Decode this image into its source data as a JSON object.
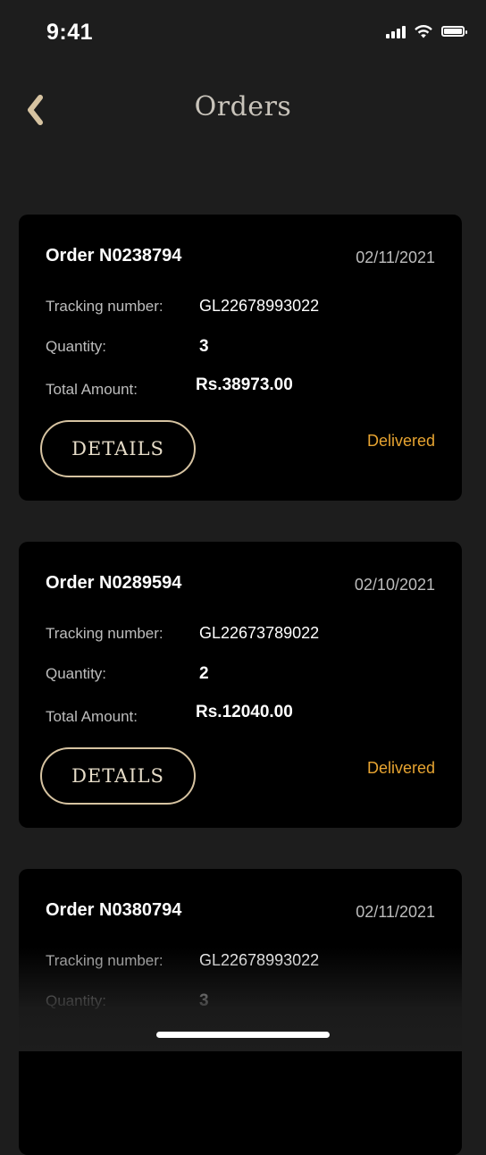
{
  "status_bar": {
    "time": "9:41"
  },
  "header": {
    "title": "Orders",
    "back_icon": "chevron-left-icon"
  },
  "labels": {
    "tracking": "Tracking number:",
    "quantity": "Quantity:",
    "total": "Total Amount:",
    "details_button": "DETAILS"
  },
  "orders": [
    {
      "title": "Order N0238794",
      "date": "02/11/2021",
      "tracking_number": "GL22678993022",
      "quantity": "3",
      "total_amount": "Rs.38973.00",
      "status": "Delivered"
    },
    {
      "title": "Order N0289594",
      "date": "02/10/2021",
      "tracking_number": "GL22673789022",
      "quantity": "2",
      "total_amount": "Rs.12040.00",
      "status": "Delivered"
    },
    {
      "title": "Order N0380794",
      "date": "02/11/2021",
      "tracking_number": "GL22678993022",
      "quantity": "3"
    }
  ],
  "colors": {
    "background": "#1d1d1d",
    "card": "#000000",
    "accent_gold": "#d6c3a1",
    "status_delivered": "#e7a431"
  }
}
